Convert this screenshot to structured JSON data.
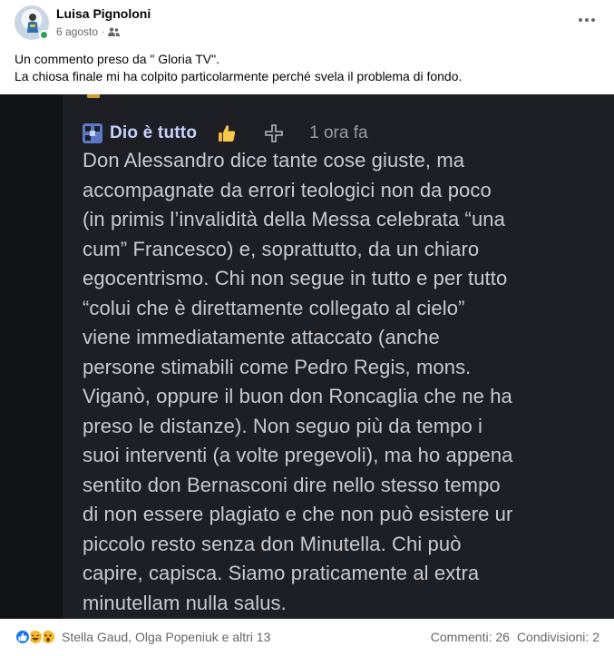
{
  "post": {
    "author": "Luisa Pignoloni",
    "date": "6 agosto",
    "separator": "·",
    "audience_icon": "friends-icon",
    "caption_lines": [
      "Un commento preso da \" Gloria TV\".",
      "La chiosa finale mi ha colpito particolarmente perché svela il problema di fondo."
    ]
  },
  "comment": {
    "username": "Dio è tutto",
    "time": "1 ora fa",
    "icons": [
      "site-logo-icon",
      "thumbs-up-icon",
      "reply-cross-icon"
    ],
    "lines": [
      "Don Alessandro dice tante cose giuste, ma",
      "accompagnate da errori teologici non da poco",
      "(in primis l’invalidità della Messa celebrata “una",
      "cum” Francesco) e, soprattutto, da un chiaro",
      "egocentrismo. Chi non segue in tutto e per tutto",
      "“colui che è direttamente collegato al cielo”",
      "viene immediatamente attaccato (anche",
      "persone stimabili come Pedro Regis, mons.",
      "Viganò, oppure il buon don Roncaglia che ne ha",
      "preso le distanze). Non seguo più da tempo i",
      "suoi interventi (a volte pregevoli), ma ho appena",
      "sentito don Bernasconi dire nello stesso tempo",
      "di non essere plagiato e che non può esistere ur",
      "piccolo resto senza don Minutella. Chi può",
      "capire, capisca. Siamo praticamente al extra",
      "minutellam nulla salus."
    ]
  },
  "footer": {
    "reaction_icons": [
      "like-reaction-icon",
      "haha-reaction-icon",
      "wow-reaction-icon"
    ],
    "reactors": "Stella Gaud, Olga Popeniuk e altri 13",
    "comments": "Commenti: 26",
    "shares": "Condivisioni: 2"
  },
  "colors": {
    "online": "#31a24c",
    "like": "#1877f2",
    "dark_bg": "#1e1f25",
    "username": "#c6d2ff"
  }
}
